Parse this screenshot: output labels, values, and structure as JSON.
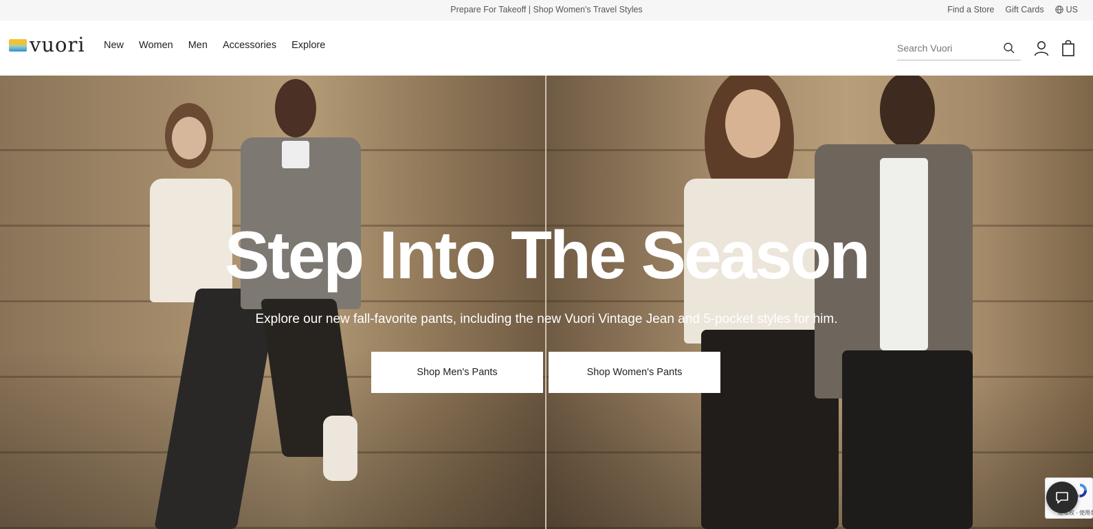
{
  "promo": {
    "text": "Prepare For Takeoff | Shop Women's Travel Styles"
  },
  "utility": {
    "find_store": "Find a Store",
    "gift_cards": "Gift Cards",
    "locale": "US"
  },
  "brand": {
    "logo_text": "vuori",
    "logo_colors": [
      "#f2c233",
      "#9cd1c2",
      "#2e8fd4"
    ]
  },
  "nav": {
    "items": [
      {
        "label": "New"
      },
      {
        "label": "Women"
      },
      {
        "label": "Men"
      },
      {
        "label": "Accessories"
      },
      {
        "label": "Explore"
      }
    ]
  },
  "search": {
    "placeholder": "Search Vuori",
    "value": ""
  },
  "icons": {
    "search": "search-icon",
    "account": "account-icon",
    "cart": "cart-icon",
    "globe": "globe-icon",
    "chat": "chat-icon"
  },
  "hero": {
    "title": "Step Into The Season",
    "subtitle": "Explore our new fall-favorite pants, including the new Vuori Vintage Jean and 5-pocket styles for him.",
    "cta_men": "Shop Men's Pants",
    "cta_women": "Shop Women's Pants"
  },
  "recaptcha": {
    "text": "隐私权 - 使用条款"
  }
}
